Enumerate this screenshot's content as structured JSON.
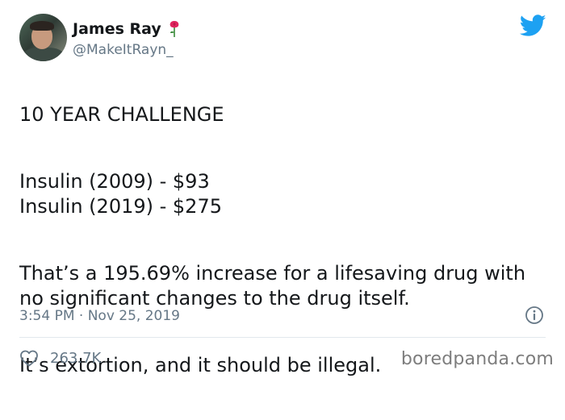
{
  "author": {
    "display_name": "James Ray",
    "handle": "@MakeItRayn_",
    "name_emoji_icon": "rose-icon"
  },
  "platform_icon": "twitter-bird-icon",
  "tweet": {
    "lines": [
      "10 YEAR CHALLENGE",
      "Insulin (2009) - $93\nInsulin (2019) - $275",
      "That’s a 195.69% increase for a lifesaving drug with no significant changes to the drug itself.",
      "It’s extortion, and it should be illegal."
    ]
  },
  "meta": {
    "timestamp": "3:54 PM · Nov 25, 2019",
    "info_icon": "info-icon"
  },
  "engagement": {
    "likes": "263.7K",
    "like_icon": "heart-icon"
  },
  "watermark": "boredpanda.com",
  "colors": {
    "twitter_blue": "#1da1f2",
    "text": "#14171a",
    "secondary_text": "#657786",
    "rose_red": "#e0245e",
    "stem_green": "#3a8a3a",
    "divider": "#e1e8ed"
  }
}
